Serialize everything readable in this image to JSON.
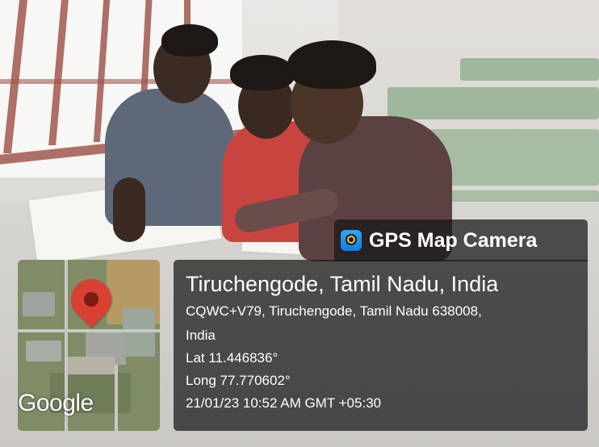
{
  "watermark": {
    "app_name": "GPS Map Camera",
    "app_icon": "gps-map-camera-app-icon"
  },
  "location": {
    "title": "Tiruchengode, Tamil Nadu, India",
    "address_line1": "CQWC+V79, Tiruchengode, Tamil Nadu 638008,",
    "address_line2": "India",
    "latitude": "Lat 11.446836°",
    "longitude": "Long 77.770602°",
    "datetime": "21/01/23 10:52 AM GMT +05:30"
  },
  "map": {
    "logo_text": "Google",
    "pin_icon": "map-pin-icon",
    "pin_color": "#d94032"
  },
  "colors": {
    "overlay": "#161616",
    "accent": "#0d7fd9"
  }
}
